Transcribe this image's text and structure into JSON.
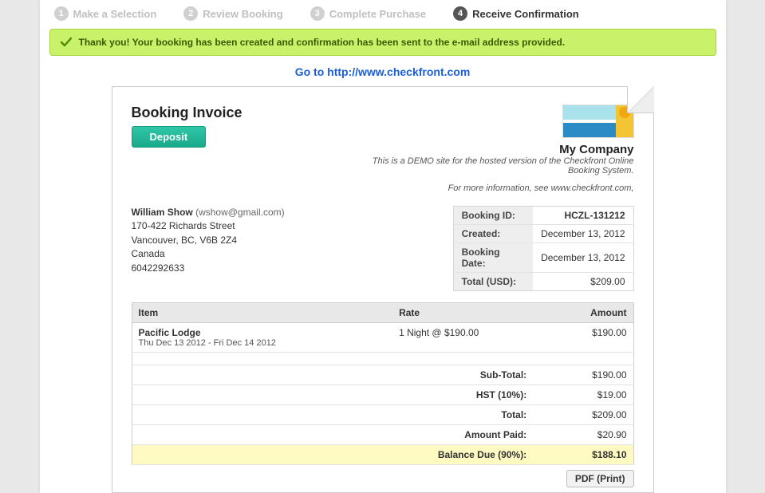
{
  "steps": [
    {
      "num": "1",
      "label": "Make a Selection"
    },
    {
      "num": "2",
      "label": "Review Booking"
    },
    {
      "num": "3",
      "label": "Complete Purchase"
    },
    {
      "num": "4",
      "label": "Receive Confirmation"
    }
  ],
  "active_step_index": 3,
  "banner_text": "Thank you! Your booking has been created and confirmation has been sent to the e-mail address provided.",
  "goto": {
    "prefix": "Go to ",
    "url": "http://www.checkfront.com"
  },
  "invoice": {
    "title": "Booking Invoice",
    "deposit_label": "Deposit",
    "company": {
      "name": "My Company",
      "desc": "This is a DEMO site for the hosted version of the Checkfront Online Booking System.",
      "info": "For more information, see www.checkfront.com,"
    },
    "customer": {
      "name": "William Show",
      "email": "(wshow@gmail.com)",
      "addr1": "170-422 Richards Street",
      "addr2": "Vancouver, BC, V6B 2Z4",
      "country": "Canada",
      "phone": "6042292633"
    },
    "meta": {
      "booking_id_k": "Booking ID:",
      "booking_id_v": "HCZL-131212",
      "created_k": "Created:",
      "created_v": "December 13, 2012",
      "booking_date_k": "Booking Date:",
      "booking_date_v": "December 13, 2012",
      "total_k": "Total (USD):",
      "total_v": "$209.00"
    },
    "columns": {
      "item": "Item",
      "rate": "Rate",
      "amount": "Amount"
    },
    "line": {
      "name": "Pacific Lodge",
      "dates": "Thu Dec 13 2012 - Fri Dec 14 2012",
      "rate": "1 Night @ $190.00",
      "amount": "$190.00"
    },
    "totals": {
      "subtotal_k": "Sub-Total:",
      "subtotal_v": "$190.00",
      "tax_k": "HST (10%):",
      "tax_v": "$19.00",
      "total_k": "Total:",
      "total_v": "$209.00",
      "paid_k": "Amount Paid:",
      "paid_v": "$20.90",
      "balance_k": "Balance Due (90%):",
      "balance_v": "$188.10"
    },
    "pdf_label": "PDF (Print)"
  }
}
